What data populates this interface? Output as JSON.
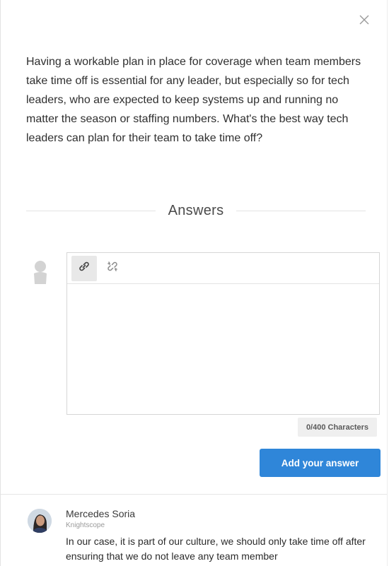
{
  "question": {
    "text": "Having a workable plan in place for coverage when team members take time off is essential for any leader, but especially so for tech leaders, who are expected to keep systems up and running no matter the season or staffing numbers. What's the best way tech leaders can plan for their team to take time off?"
  },
  "answers_section": {
    "heading": "Answers"
  },
  "editor": {
    "toolbar": [
      "link-icon",
      "unlink-icon"
    ],
    "value": "",
    "char_count": "0/400 Characters"
  },
  "submit_label": "Add your answer",
  "answers": [
    {
      "name": "Mercedes Soria",
      "company": "Knightscope",
      "text": "In our case, it is part of our culture, we should only take time off after ensuring that we do not leave any team member"
    }
  ],
  "colors": {
    "accent": "#2f86d9",
    "text": "#2f2f2f"
  }
}
